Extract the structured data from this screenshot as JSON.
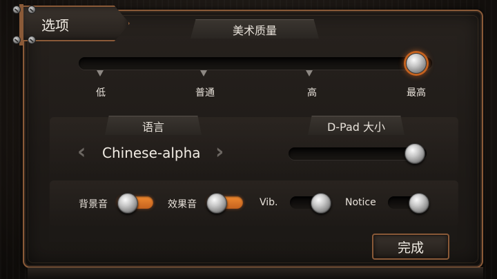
{
  "dialog": {
    "title": "选项",
    "done_label": "完成"
  },
  "art_quality": {
    "header": "美术质量",
    "levels": [
      "低",
      "普通",
      "高",
      "最高"
    ],
    "selected_index": 3
  },
  "language": {
    "header": "语言",
    "value": "Chinese-alpha",
    "prev_icon": "chevron-left-icon",
    "next_icon": "chevron-right-icon"
  },
  "dpad": {
    "header": "D-Pad 大小",
    "level_fraction": 0.95
  },
  "toggles": {
    "music_label": "背景音",
    "music_on": true,
    "sfx_label": "效果音",
    "sfx_on": true,
    "vib_label": "Vib.",
    "vib_on": false,
    "notice_label": "Notice",
    "notice_on": false
  },
  "colors": {
    "accent_orange": "#e07a2c",
    "frame_bronze": "#8a5a38"
  }
}
